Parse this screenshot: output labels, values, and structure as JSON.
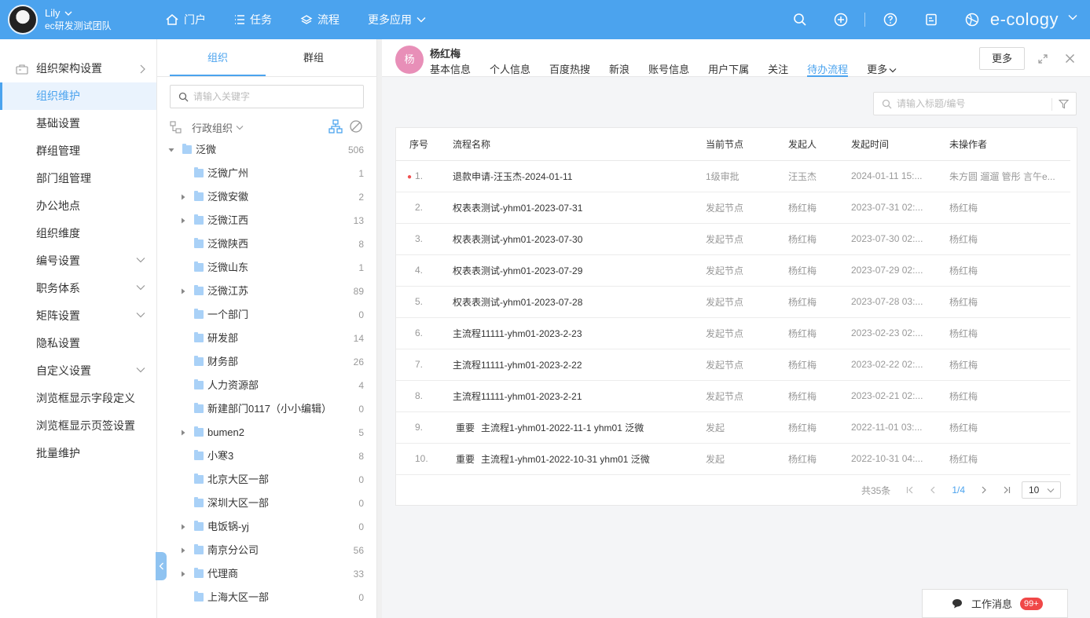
{
  "header": {
    "user_name": "Lily",
    "user_team": "ec研发测试团队",
    "nav": [
      {
        "label": "门户",
        "icon": "home-icon"
      },
      {
        "label": "任务",
        "icon": "list-icon"
      },
      {
        "label": "流程",
        "icon": "layers-icon"
      },
      {
        "label": "更多应用",
        "icon": "chevron-down-icon"
      }
    ],
    "icons": [
      "search-icon",
      "plus-circle-icon",
      "help-icon",
      "notes-icon",
      "globe-icon"
    ],
    "brand": "e-cology",
    "color": "#4ba3ee"
  },
  "left_menu": {
    "items": [
      {
        "label": "组织架构设置",
        "arrow": "right"
      },
      {
        "label": "组织维护",
        "active": true
      },
      {
        "label": "基础设置"
      },
      {
        "label": "群组管理"
      },
      {
        "label": "部门组管理"
      },
      {
        "label": "办公地点"
      },
      {
        "label": "组织维度"
      },
      {
        "label": "编号设置",
        "arrow": "down"
      },
      {
        "label": "职务体系",
        "arrow": "down"
      },
      {
        "label": "矩阵设置",
        "arrow": "down"
      },
      {
        "label": "隐私设置"
      },
      {
        "label": "自定义设置",
        "arrow": "down"
      },
      {
        "label": "浏览框显示字段定义"
      },
      {
        "label": "浏览框显示页签设置"
      },
      {
        "label": "批量维护"
      }
    ]
  },
  "tree_panel": {
    "tabs": [
      "组织",
      "群组"
    ],
    "search_placeholder": "请输入关键字",
    "org_type": "行政组织",
    "nodes": [
      {
        "label": "泛微",
        "count": "506",
        "level": 0,
        "expanded": true
      },
      {
        "label": "泛微广州",
        "count": "1",
        "level": 1,
        "has_children": false
      },
      {
        "label": "泛微安徽",
        "count": "2",
        "level": 1,
        "has_children": true
      },
      {
        "label": "泛微江西",
        "count": "13",
        "level": 1,
        "has_children": true
      },
      {
        "label": "泛微陕西",
        "count": "8",
        "level": 1,
        "has_children": false
      },
      {
        "label": "泛微山东",
        "count": "1",
        "level": 1,
        "has_children": false
      },
      {
        "label": "泛微江苏",
        "count": "89",
        "level": 1,
        "has_children": true
      },
      {
        "label": "一个部门",
        "count": "0",
        "level": 1,
        "has_children": false
      },
      {
        "label": "研发部",
        "count": "14",
        "level": 1,
        "has_children": false
      },
      {
        "label": "财务部",
        "count": "26",
        "level": 1,
        "has_children": false
      },
      {
        "label": "人力资源部",
        "count": "4",
        "level": 1,
        "has_children": false
      },
      {
        "label": "新建部门0117（小小编辑）",
        "count": "0",
        "level": 1,
        "has_children": false
      },
      {
        "label": "bumen2",
        "count": "5",
        "level": 1,
        "has_children": true
      },
      {
        "label": "小寒3",
        "count": "8",
        "level": 1,
        "has_children": false
      },
      {
        "label": "北京大区一部",
        "count": "0",
        "level": 1,
        "has_children": false
      },
      {
        "label": "深圳大区一部",
        "count": "0",
        "level": 1,
        "has_children": false
      },
      {
        "label": "电饭锅-yj",
        "count": "0",
        "level": 1,
        "has_children": true
      },
      {
        "label": "南京分公司",
        "count": "56",
        "level": 1,
        "has_children": true
      },
      {
        "label": "代理商",
        "count": "33",
        "level": 1,
        "has_children": true
      },
      {
        "label": "上海大区一部",
        "count": "0",
        "level": 1,
        "has_children": false
      }
    ]
  },
  "profile": {
    "avatar_text": "杨",
    "name": "杨红梅",
    "tabs": [
      "基本信息",
      "个人信息",
      "百度热搜",
      "新浪",
      "账号信息",
      "用户下属",
      "关注",
      "待办流程",
      "更多"
    ],
    "active_tab": "待办流程",
    "more_button": "更多",
    "search_placeholder": "请输入标题/编号",
    "avatar_color": "#e88fb8"
  },
  "table": {
    "headers": [
      "序号",
      "流程名称",
      "当前节点",
      "发起人",
      "发起时间",
      "未操作者"
    ],
    "rows": [
      {
        "idx": "1.",
        "unread": true,
        "important": "",
        "name": "退款申请-汪玉杰-2024-01-11",
        "node": "1级审批",
        "creator": "汪玉杰",
        "time": "2024-01-11 15:...",
        "pending": "朱方圆 遛遛 管彤 言午e..."
      },
      {
        "idx": "2.",
        "important": "",
        "name": "权表表测试-yhm01-2023-07-31",
        "node": "发起节点",
        "creator": "杨红梅",
        "time": "2023-07-31 02:...",
        "pending": "杨红梅"
      },
      {
        "idx": "3.",
        "important": "",
        "name": "权表表测试-yhm01-2023-07-30",
        "node": "发起节点",
        "creator": "杨红梅",
        "time": "2023-07-30 02:...",
        "pending": "杨红梅"
      },
      {
        "idx": "4.",
        "important": "",
        "name": "权表表测试-yhm01-2023-07-29",
        "node": "发起节点",
        "creator": "杨红梅",
        "time": "2023-07-29 02:...",
        "pending": "杨红梅"
      },
      {
        "idx": "5.",
        "important": "",
        "name": "权表表测试-yhm01-2023-07-28",
        "node": "发起节点",
        "creator": "杨红梅",
        "time": "2023-07-28 03:...",
        "pending": "杨红梅"
      },
      {
        "idx": "6.",
        "important": "",
        "name": "主流程11111-yhm01-2023-2-23",
        "node": "发起节点",
        "creator": "杨红梅",
        "time": "2023-02-23 02:...",
        "pending": "杨红梅"
      },
      {
        "idx": "7.",
        "important": "",
        "name": "主流程11111-yhm01-2023-2-22",
        "node": "发起节点",
        "creator": "杨红梅",
        "time": "2023-02-22 02:...",
        "pending": "杨红梅"
      },
      {
        "idx": "8.",
        "important": "",
        "name": "主流程11111-yhm01-2023-2-21",
        "node": "发起节点",
        "creator": "杨红梅",
        "time": "2023-02-21 02:...",
        "pending": "杨红梅"
      },
      {
        "idx": "9.",
        "important": "重要",
        "name": "主流程1-yhm01-2022-11-1  yhm01  泛微",
        "node": "发起",
        "creator": "杨红梅",
        "time": "2022-11-01 03:...",
        "pending": "杨红梅"
      },
      {
        "idx": "10.",
        "important": "重要",
        "name": "主流程1-yhm01-2022-10-31  yhm01  泛微",
        "node": "发起",
        "creator": "杨红梅",
        "time": "2022-10-31 04:...",
        "pending": "杨红梅"
      }
    ]
  },
  "pagination": {
    "total": "共35条",
    "current": "1/4",
    "page_size": "10"
  },
  "work_message": {
    "label": "工作消息",
    "badge": "99+"
  }
}
